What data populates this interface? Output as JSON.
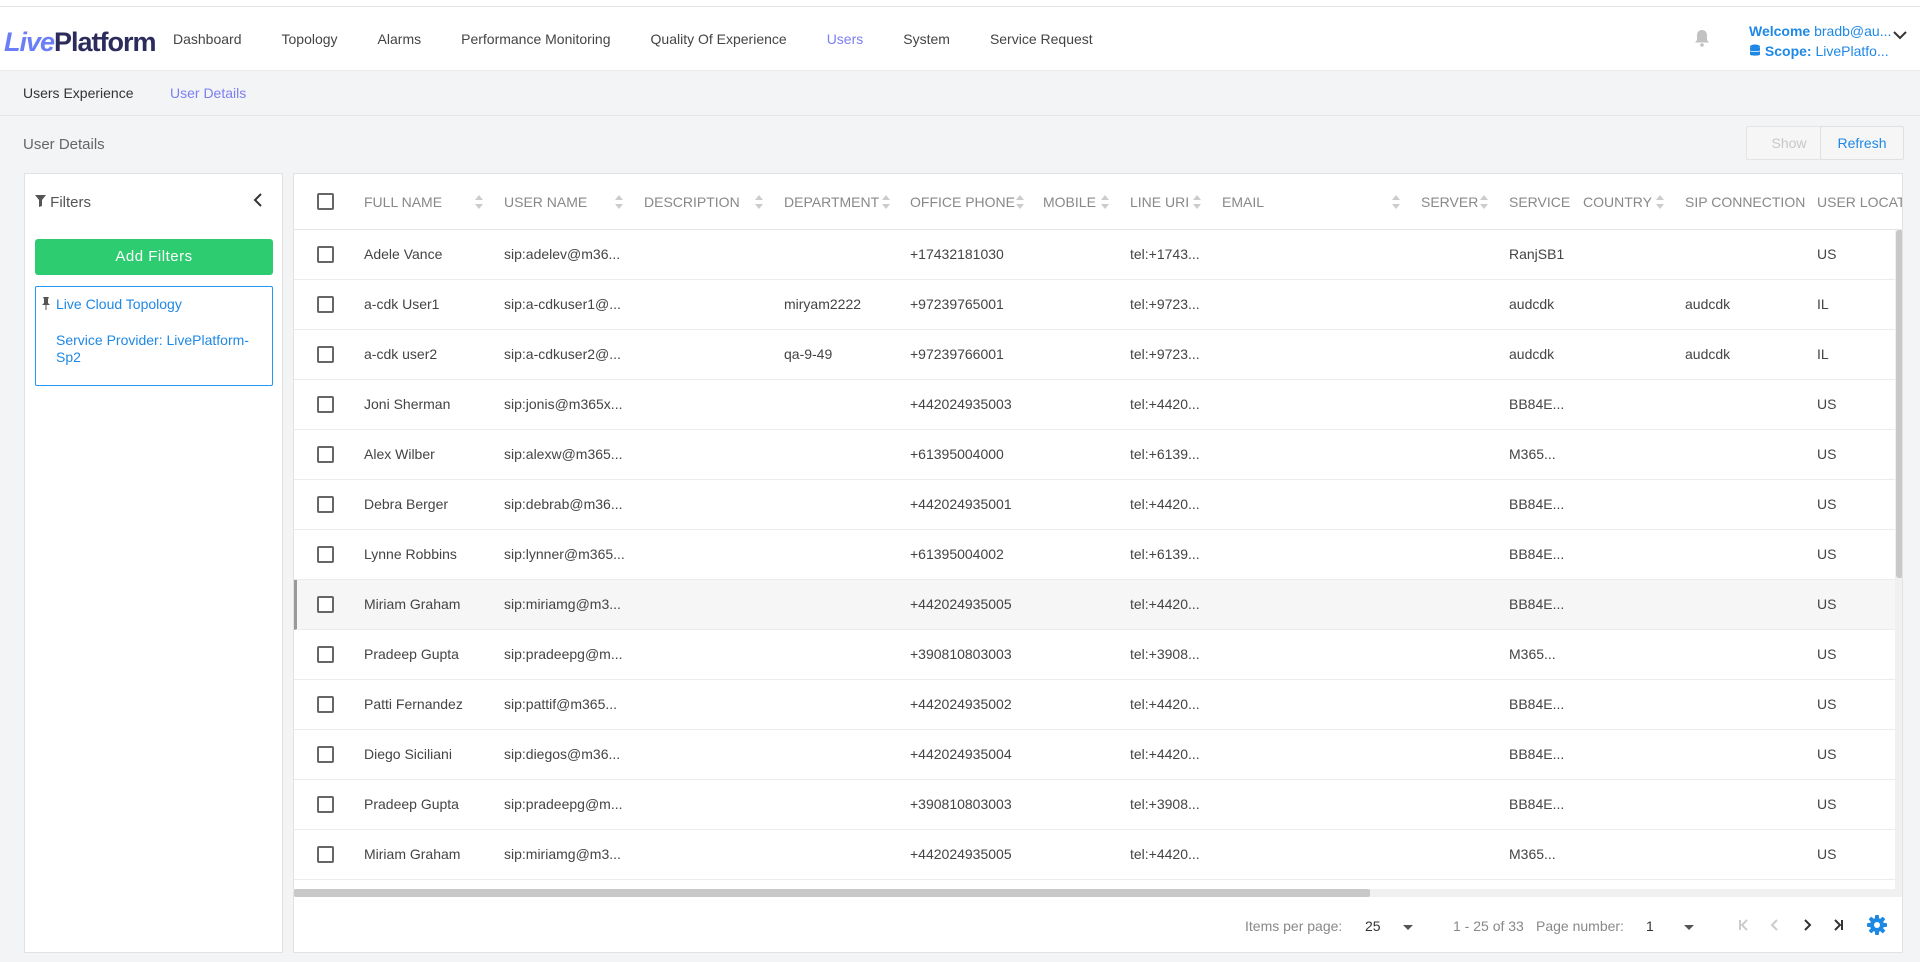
{
  "app": {
    "logo_live": "Live",
    "logo_platform": "Platform"
  },
  "nav": {
    "items": [
      {
        "label": "Dashboard"
      },
      {
        "label": "Topology"
      },
      {
        "label": "Alarms"
      },
      {
        "label": "Performance Monitoring"
      },
      {
        "label": "Quality Of Experience"
      },
      {
        "label": "Users",
        "active": true
      },
      {
        "label": "System"
      },
      {
        "label": "Service Request"
      }
    ]
  },
  "user": {
    "welcome_label": "Welcome",
    "welcome_value": "bradb@au...",
    "scope_label": "Scope:",
    "scope_value": "LivePlatfo..."
  },
  "subnav": {
    "items": [
      {
        "label": "Users Experience"
      },
      {
        "label": "User Details",
        "active": true
      }
    ]
  },
  "page": {
    "title": "User Details",
    "show_label": "Show",
    "refresh_label": "Refresh"
  },
  "filters": {
    "title": "Filters",
    "add_label": "Add Filters",
    "topology_title": "Live Cloud Topology",
    "topology_value": "Service Provider: LivePlatform-Sp2"
  },
  "table": {
    "columns": [
      "FULL NAME",
      "USER NAME",
      "DESCRIPTION",
      "DEPARTMENT",
      "OFFICE PHONE",
      "MOBILE",
      "LINE URI",
      "EMAIL",
      "SERVER",
      "SERVICE",
      "COUNTRY",
      "SIP CONNECTION",
      "USER LOCATI"
    ],
    "rows": [
      {
        "full_name": "Adele Vance",
        "user_name": "sip:adelev@m36...",
        "department": "",
        "office_phone": "+17432181030",
        "line_uri": "tel:+1743...",
        "service": "RanjSB1",
        "sip": "",
        "location": "US"
      },
      {
        "full_name": "a-cdk User1",
        "user_name": "sip:a-cdkuser1@...",
        "department": "miryam2222",
        "office_phone": "+97239765001",
        "line_uri": "tel:+9723...",
        "service": "audcdk",
        "sip": "audcdk",
        "location": "IL"
      },
      {
        "full_name": "a-cdk user2",
        "user_name": "sip:a-cdkuser2@...",
        "department": "qa-9-49",
        "office_phone": "+97239766001",
        "line_uri": "tel:+9723...",
        "service": "audcdk",
        "sip": "audcdk",
        "location": "IL"
      },
      {
        "full_name": "Joni Sherman",
        "user_name": "sip:jonis@m365x...",
        "department": "",
        "office_phone": "+442024935003",
        "line_uri": "tel:+4420...",
        "service": "BB84E...",
        "sip": "",
        "location": "US"
      },
      {
        "full_name": "Alex Wilber",
        "user_name": "sip:alexw@m365...",
        "department": "",
        "office_phone": "+61395004000",
        "line_uri": "tel:+6139...",
        "service": "M365...",
        "sip": "",
        "location": "US"
      },
      {
        "full_name": "Debra Berger",
        "user_name": "sip:debrab@m36...",
        "department": "",
        "office_phone": "+442024935001",
        "line_uri": "tel:+4420...",
        "service": "BB84E...",
        "sip": "",
        "location": "US"
      },
      {
        "full_name": "Lynne Robbins",
        "user_name": "sip:lynner@m365...",
        "department": "",
        "office_phone": "+61395004002",
        "line_uri": "tel:+6139...",
        "service": "BB84E...",
        "sip": "",
        "location": "US"
      },
      {
        "full_name": "Miriam Graham",
        "user_name": "sip:miriamg@m3...",
        "department": "",
        "office_phone": "+442024935005",
        "line_uri": "tel:+4420...",
        "service": "BB84E...",
        "sip": "",
        "location": "US"
      },
      {
        "full_name": "Pradeep Gupta",
        "user_name": "sip:pradeepg@m...",
        "department": "",
        "office_phone": "+390810803003",
        "line_uri": "tel:+3908...",
        "service": "M365...",
        "sip": "",
        "location": "US"
      },
      {
        "full_name": "Patti Fernandez",
        "user_name": "sip:pattif@m365...",
        "department": "",
        "office_phone": "+442024935002",
        "line_uri": "tel:+4420...",
        "service": "BB84E...",
        "sip": "",
        "location": "US"
      },
      {
        "full_name": "Diego Siciliani",
        "user_name": "sip:diegos@m36...",
        "department": "",
        "office_phone": "+442024935004",
        "line_uri": "tel:+4420...",
        "service": "BB84E...",
        "sip": "",
        "location": "US"
      },
      {
        "full_name": "Pradeep Gupta",
        "user_name": "sip:pradeepg@m...",
        "department": "",
        "office_phone": "+390810803003",
        "line_uri": "tel:+3908...",
        "service": "BB84E...",
        "sip": "",
        "location": "US"
      },
      {
        "full_name": "Miriam Graham",
        "user_name": "sip:miriamg@m3...",
        "department": "",
        "office_phone": "+442024935005",
        "line_uri": "tel:+4420...",
        "service": "M365...",
        "sip": "",
        "location": "US"
      }
    ]
  },
  "pager": {
    "items_per_page_label": "Items per page:",
    "items_per_page": "25",
    "range": "1 - 25 of 33",
    "page_number_label": "Page number:",
    "page_number": "1"
  },
  "colors": {
    "accent": "#7b7ff0",
    "link": "#1e88e5",
    "add_button": "#2ecc71"
  },
  "icons": [
    "bell-icon",
    "chevron-down-icon",
    "database-icon",
    "filter-icon",
    "chevron-left-icon",
    "pin-icon",
    "sort-icon",
    "first-page-icon",
    "prev-page-icon",
    "next-page-icon",
    "last-page-icon",
    "gear-icon"
  ]
}
